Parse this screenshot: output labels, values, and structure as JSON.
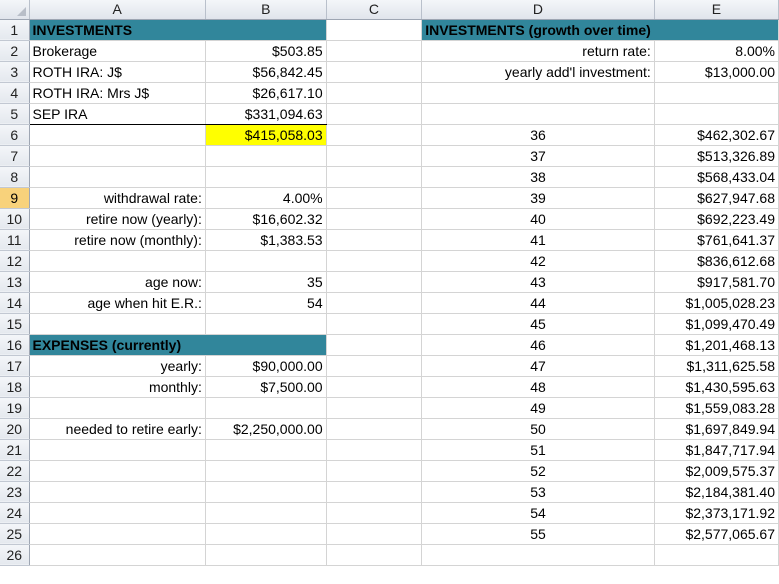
{
  "columns": [
    "A",
    "B",
    "C",
    "D",
    "E"
  ],
  "selected_row": 9,
  "colors": {
    "header_fill": "#31869b",
    "highlight_fill": "#ffff00",
    "selected_row_header": "#f8d27b"
  },
  "rows": [
    {
      "n": "1",
      "a": "INVESTMENTS",
      "b": "",
      "c": "",
      "d": "INVESTMENTS (growth over time)",
      "e": ""
    },
    {
      "n": "2",
      "a": "Brokerage",
      "b": "$503.85",
      "c": "",
      "d": "return rate:",
      "e": "8.00%"
    },
    {
      "n": "3",
      "a": "ROTH IRA: J$",
      "b": "$56,842.45",
      "c": "",
      "d": "yearly add'l investment:",
      "e": "$13,000.00"
    },
    {
      "n": "4",
      "a": "ROTH IRA: Mrs J$",
      "b": "$26,617.10",
      "c": "",
      "d": "",
      "e": ""
    },
    {
      "n": "5",
      "a": "SEP IRA",
      "b": "$331,094.63",
      "c": "",
      "d": "",
      "e": ""
    },
    {
      "n": "6",
      "a": "",
      "b": "$415,058.03",
      "c": "",
      "d": "36",
      "e": "$462,302.67"
    },
    {
      "n": "7",
      "a": "",
      "b": "",
      "c": "",
      "d": "37",
      "e": "$513,326.89"
    },
    {
      "n": "8",
      "a": "",
      "b": "",
      "c": "",
      "d": "38",
      "e": "$568,433.04"
    },
    {
      "n": "9",
      "a": "withdrawal rate:",
      "b": "4.00%",
      "c": "",
      "d": "39",
      "e": "$627,947.68"
    },
    {
      "n": "10",
      "a": "retire now (yearly):",
      "b": "$16,602.32",
      "c": "",
      "d": "40",
      "e": "$692,223.49"
    },
    {
      "n": "11",
      "a": "retire now (monthly):",
      "b": "$1,383.53",
      "c": "",
      "d": "41",
      "e": "$761,641.37"
    },
    {
      "n": "12",
      "a": "",
      "b": "",
      "c": "",
      "d": "42",
      "e": "$836,612.68"
    },
    {
      "n": "13",
      "a": "age now:",
      "b": "35",
      "c": "",
      "d": "43",
      "e": "$917,581.70"
    },
    {
      "n": "14",
      "a": "age when hit E.R.:",
      "b": "54",
      "c": "",
      "d": "44",
      "e": "$1,005,028.23"
    },
    {
      "n": "15",
      "a": "",
      "b": "",
      "c": "",
      "d": "45",
      "e": "$1,099,470.49"
    },
    {
      "n": "16",
      "a": "EXPENSES (currently)",
      "b": "",
      "c": "",
      "d": "46",
      "e": "$1,201,468.13"
    },
    {
      "n": "17",
      "a": "yearly:",
      "b": "$90,000.00",
      "c": "",
      "d": "47",
      "e": "$1,311,625.58"
    },
    {
      "n": "18",
      "a": "monthly:",
      "b": "$7,500.00",
      "c": "",
      "d": "48",
      "e": "$1,430,595.63"
    },
    {
      "n": "19",
      "a": "",
      "b": "",
      "c": "",
      "d": "49",
      "e": "$1,559,083.28"
    },
    {
      "n": "20",
      "a": "needed to retire early:",
      "b": "$2,250,000.00",
      "c": "",
      "d": "50",
      "e": "$1,697,849.94"
    },
    {
      "n": "21",
      "a": "",
      "b": "",
      "c": "",
      "d": "51",
      "e": "$1,847,717.94"
    },
    {
      "n": "22",
      "a": "",
      "b": "",
      "c": "",
      "d": "52",
      "e": "$2,009,575.37"
    },
    {
      "n": "23",
      "a": "",
      "b": "",
      "c": "",
      "d": "53",
      "e": "$2,184,381.40"
    },
    {
      "n": "24",
      "a": "",
      "b": "",
      "c": "",
      "d": "54",
      "e": "$2,373,171.92"
    },
    {
      "n": "25",
      "a": "",
      "b": "",
      "c": "",
      "d": "55",
      "e": "$2,577,065.67"
    },
    {
      "n": "26",
      "a": "",
      "b": "",
      "c": "",
      "d": "",
      "e": ""
    }
  ]
}
